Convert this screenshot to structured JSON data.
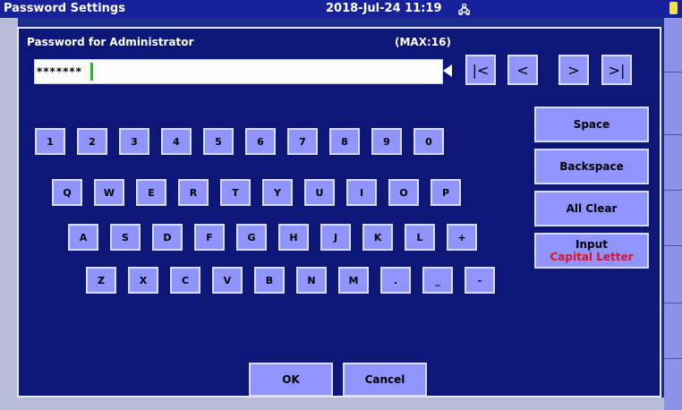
{
  "title_bar": {
    "title": "Password Settings",
    "datetime": "2018-Jul-24 11:19",
    "network_icon": "network-icon",
    "battery_icon": "battery-icon"
  },
  "dialog": {
    "label": "Password for Administrator",
    "max_label": "(MAX:16)",
    "password_value": "*******",
    "nav": {
      "first": "|<",
      "prev": "<",
      "next": ">",
      "last": ">|"
    },
    "keys_row1": [
      "1",
      "2",
      "3",
      "4",
      "5",
      "6",
      "7",
      "8",
      "9",
      "0"
    ],
    "keys_row2": [
      "Q",
      "W",
      "E",
      "R",
      "T",
      "Y",
      "U",
      "I",
      "O",
      "P"
    ],
    "keys_row3": [
      "A",
      "S",
      "D",
      "F",
      "G",
      "H",
      "J",
      "K",
      "L",
      "+"
    ],
    "keys_row4": [
      "Z",
      "X",
      "C",
      "V",
      "B",
      "N",
      "M",
      ".",
      "_",
      "-"
    ],
    "side_buttons": {
      "space": "Space",
      "backspace": "Backspace",
      "all_clear": "All Clear",
      "input": "Input",
      "input_mode": "Capital Letter"
    },
    "ok": "OK",
    "cancel": "Cancel"
  }
}
